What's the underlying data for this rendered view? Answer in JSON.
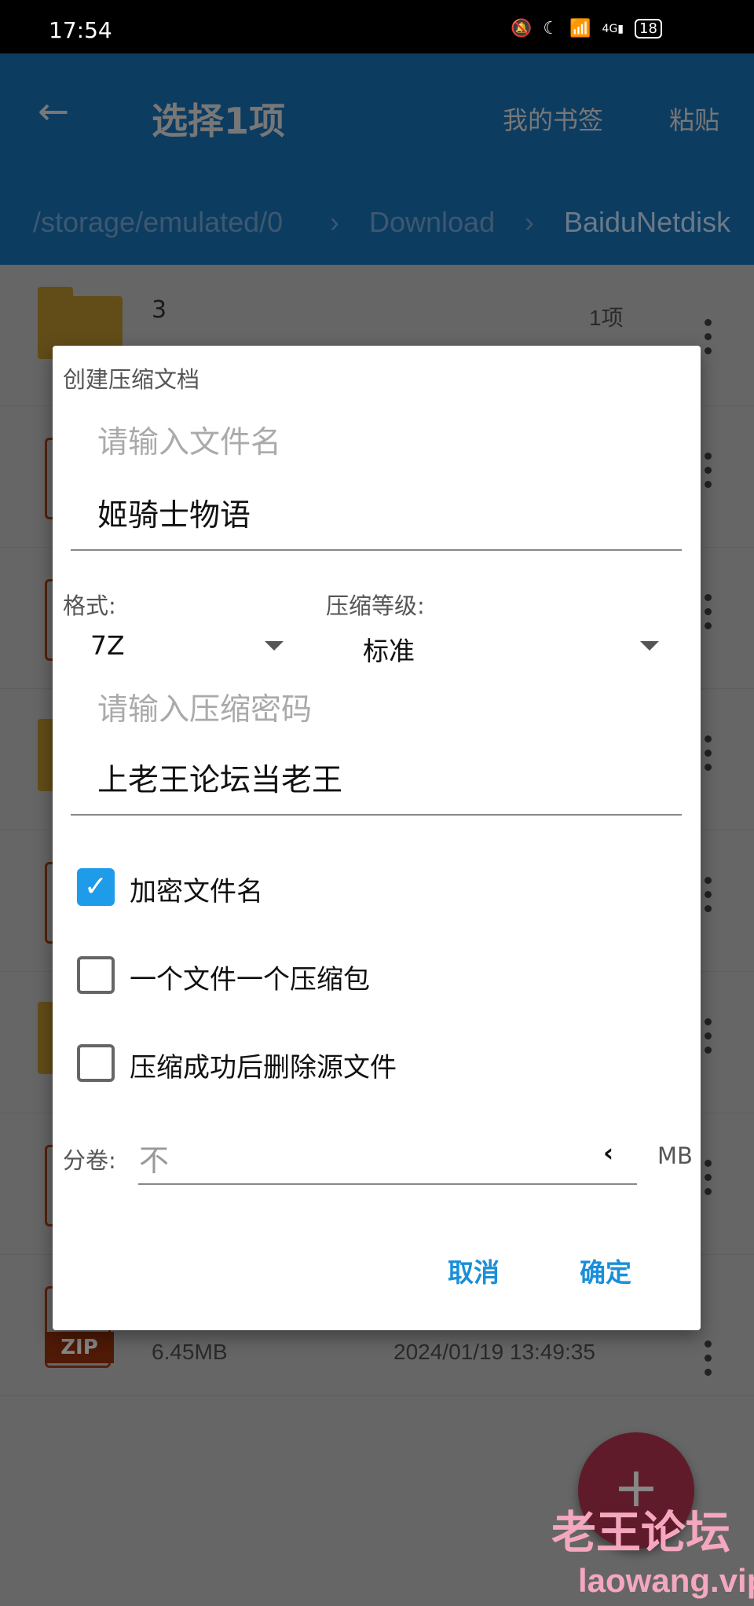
{
  "status_bar": {
    "time": "17:54",
    "icons": [
      "mute-vibrate-icon",
      "moon-icon",
      "wifi-icon",
      "4g-signal-icon",
      "battery-icon"
    ],
    "battery": "18"
  },
  "app_bar": {
    "title": "选择1项",
    "bookmarks": "我的书签",
    "paste": "粘贴",
    "breadcrumbs": [
      "/storage/emulated/0",
      "Download",
      "BaiduNetdisk"
    ]
  },
  "list": {
    "first_row": {
      "name": "3",
      "info": "1项"
    },
    "last_row": {
      "type": "ZIP",
      "size": "6.45MB",
      "date": "2024/01/19 13:49:35"
    }
  },
  "dialog": {
    "title": "创建压缩文档",
    "filename_placeholder": "请输入文件名",
    "filename_value": "姬骑士物语",
    "format_label": "格式:",
    "format_value": "7Z",
    "level_label": "压缩等级:",
    "level_value": "标准",
    "password_placeholder": "请输入压缩密码",
    "password_value": "上老王论坛当老王",
    "options": [
      {
        "label": "加密文件名",
        "checked": true
      },
      {
        "label": "一个文件一个压缩包",
        "checked": false
      },
      {
        "label": "压缩成功后删除源文件",
        "checked": false
      }
    ],
    "split_label": "分卷:",
    "split_value": "不",
    "split_unit": "MB",
    "cancel": "取消",
    "ok": "确定"
  },
  "watermark": {
    "title": "老王论坛",
    "url": "laowang.vip"
  },
  "colors": {
    "accent": "#1e9be9",
    "appbar": "#2196f3",
    "fab": "#f0436a"
  }
}
